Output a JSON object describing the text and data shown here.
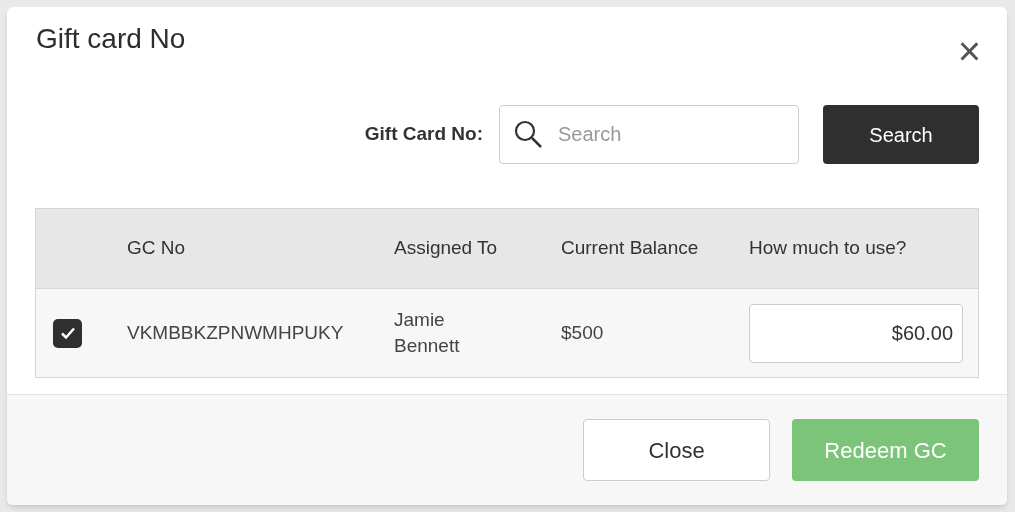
{
  "dialog": {
    "title": "Gift card No",
    "close": "×"
  },
  "search": {
    "label": "Gift Card No:",
    "placeholder": "Search",
    "button": "Search"
  },
  "table": {
    "columns": [
      "GC No",
      "Assigned To",
      "Current Balance",
      "How much to use?"
    ],
    "rows": [
      {
        "checked": true,
        "gc_no": "VKMBBKZPNWMHPUKY",
        "assigned_to": "Jamie Bennett",
        "current_balance": "$500",
        "amount": "$60.00"
      }
    ]
  },
  "footer": {
    "buttons": [
      {
        "label": "Close",
        "kind": "secondary"
      },
      {
        "label": "Redeem GC",
        "kind": "primary"
      }
    ]
  }
}
